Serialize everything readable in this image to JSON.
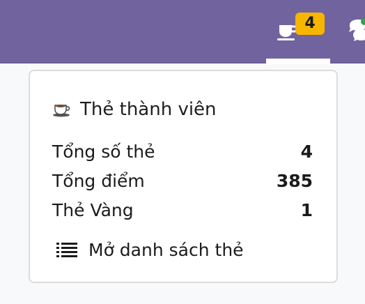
{
  "navbar": {
    "badge_count": "4",
    "cup_icon": "cup-icon",
    "chat_icon": "chat-icon",
    "accent": "#71639e",
    "badge_color": "#f7b500",
    "status_dot_color": "#28a745"
  },
  "dropdown": {
    "title": "Thẻ thành viên",
    "title_icon": "coffee-cup-icon",
    "stats": [
      {
        "label": "Tổng số thẻ",
        "value": "4"
      },
      {
        "label": "Tổng điểm",
        "value": "385"
      },
      {
        "label": "Thẻ Vàng",
        "value": "1"
      }
    ],
    "link_label": "Mở danh sách thẻ",
    "link_icon": "list-icon"
  }
}
